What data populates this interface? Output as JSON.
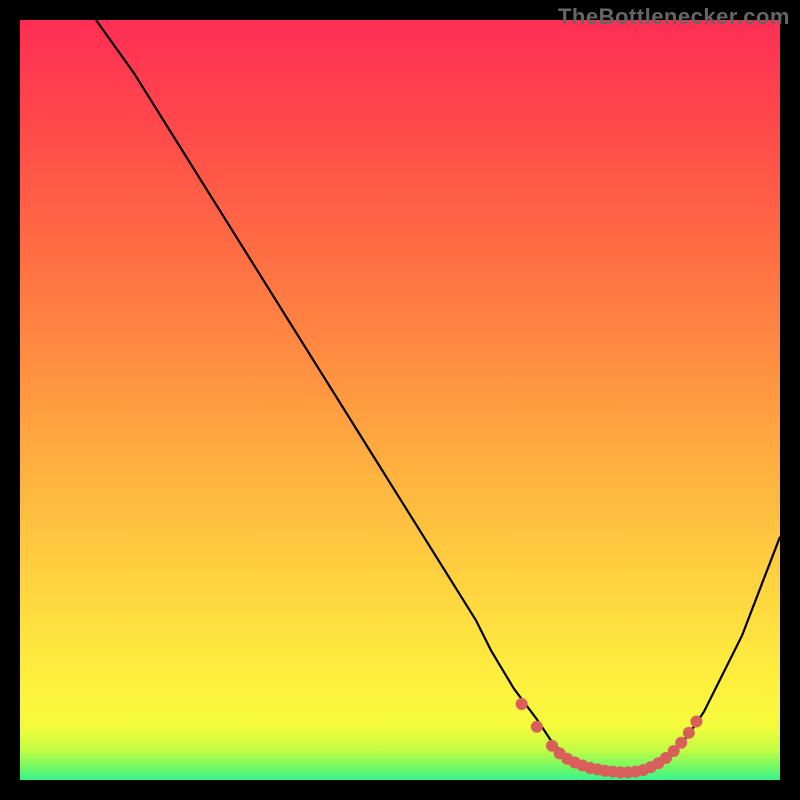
{
  "attribution": "TheBottlenecker.com",
  "chart_data": {
    "type": "line",
    "title": "",
    "xlabel": "",
    "ylabel": "",
    "xlim": [
      0,
      100
    ],
    "ylim": [
      0,
      100
    ],
    "series": [
      {
        "name": "curve",
        "color": "#000000",
        "x": [
          10,
          15,
          20,
          25,
          30,
          35,
          40,
          45,
          50,
          55,
          60,
          62,
          65,
          68,
          70,
          72,
          74,
          76,
          78,
          80,
          82,
          84,
          86,
          88,
          90,
          92,
          95,
          100
        ],
        "y": [
          100,
          93,
          85,
          77,
          69,
          61,
          53,
          45,
          37,
          29,
          21,
          17,
          12,
          8,
          5,
          3,
          2,
          1.2,
          1,
          1,
          1.2,
          2,
          3.5,
          6,
          9,
          13,
          19,
          32
        ]
      },
      {
        "name": "markers",
        "color": "#d9605a",
        "type": "scatter",
        "x": [
          66,
          68,
          70,
          71,
          72,
          73,
          74,
          75,
          76,
          77,
          78,
          79,
          80,
          81,
          82,
          83,
          84,
          85,
          86,
          87,
          88,
          89
        ],
        "y": [
          10,
          7,
          4.5,
          3.5,
          2.8,
          2.3,
          1.9,
          1.6,
          1.4,
          1.2,
          1.1,
          1.0,
          1.0,
          1.1,
          1.3,
          1.7,
          2.2,
          2.9,
          3.8,
          4.9,
          6.2,
          7.7
        ]
      }
    ],
    "background_gradient": {
      "stops": [
        {
          "offset": 0.0,
          "color": "#36f48e"
        },
        {
          "offset": 0.02,
          "color": "#7ef95f"
        },
        {
          "offset": 0.04,
          "color": "#c4fd43"
        },
        {
          "offset": 0.07,
          "color": "#f4fb3c"
        },
        {
          "offset": 0.12,
          "color": "#fef23e"
        },
        {
          "offset": 0.25,
          "color": "#ffd53f"
        },
        {
          "offset": 0.4,
          "color": "#ffb340"
        },
        {
          "offset": 0.55,
          "color": "#ff8e41"
        },
        {
          "offset": 0.7,
          "color": "#ff6c43"
        },
        {
          "offset": 0.85,
          "color": "#ff4b4a"
        },
        {
          "offset": 1.0,
          "color": "#ff2e55"
        }
      ]
    }
  }
}
